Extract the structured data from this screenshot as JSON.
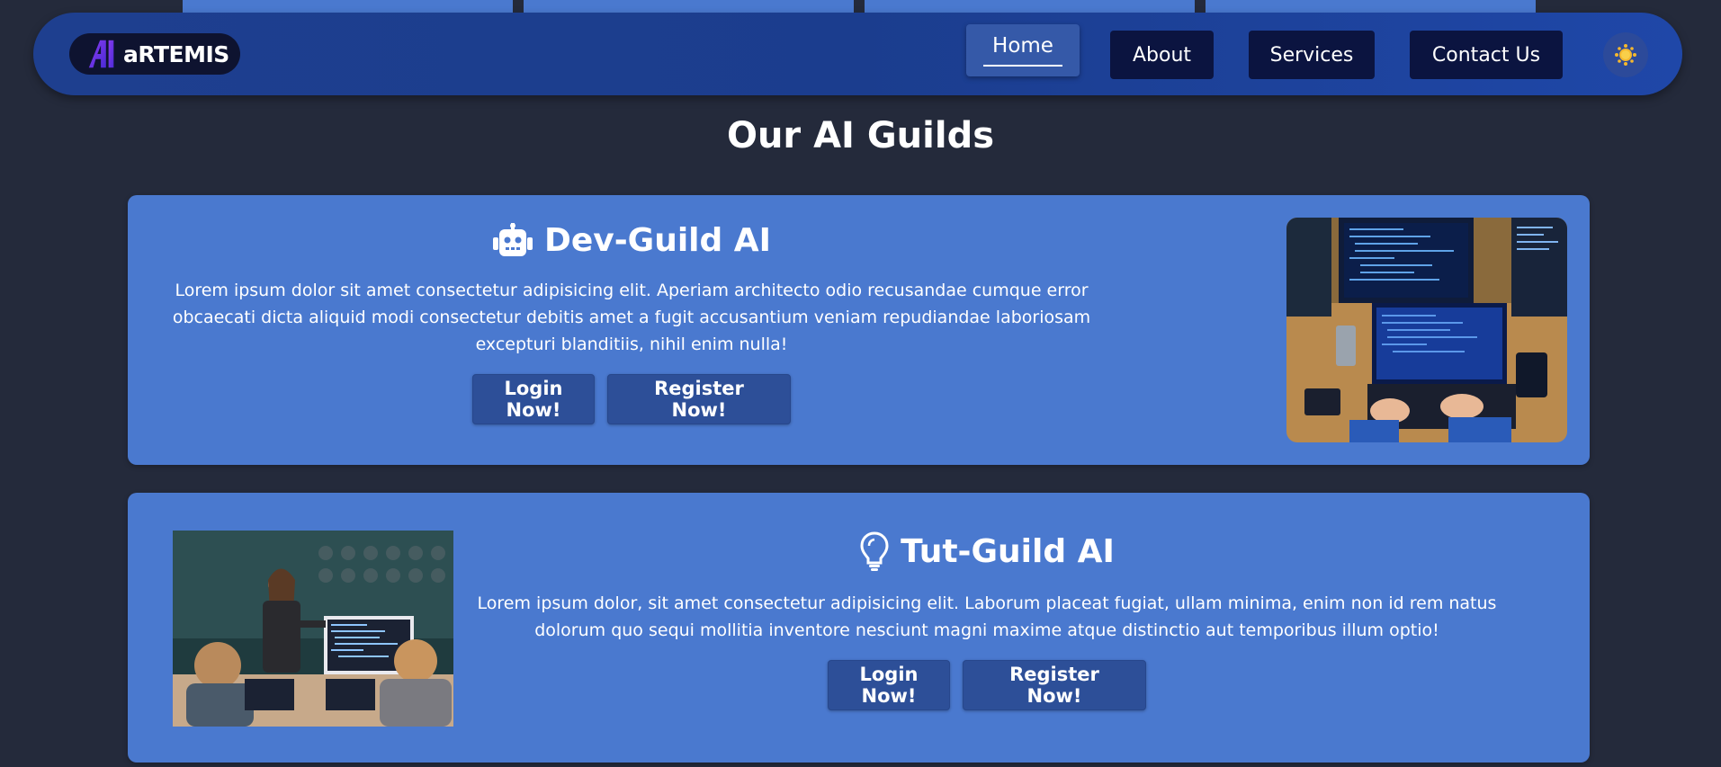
{
  "navbar": {
    "logo_text": "aRTEMIS",
    "links": [
      "Home",
      "About",
      "Services",
      "Contact Us"
    ],
    "active": "Home"
  },
  "section": {
    "title": "Our AI Guilds"
  },
  "guilds": [
    {
      "title": "Dev-Guild AI",
      "icon": "robot-icon",
      "description": "Lorem ipsum dolor sit amet consectetur adipisicing elit. Aperiam architecto odio recusandae cumque error obcaecati dicta aliquid modi consectetur debitis amet a fugit accusantium veniam repudiandae laboriosam excepturi blanditiis, nihil enim nulla!",
      "login_label": "Login Now!",
      "register_label": "Register Now!"
    },
    {
      "title": "Tut-Guild AI",
      "icon": "lightbulb-icon",
      "description": "Lorem ipsum dolor, sit amet consectetur adipisicing elit. Laborum placeat fugiat, ullam minima, enim non id rem natus dolorum quo sequi mollitia inventore nesciunt magni maxime atque distinctio aut temporibus illum optio!",
      "login_label": "Login Now!",
      "register_label": "Register Now!"
    }
  ],
  "colors": {
    "background": "#242a3b",
    "navbar": "#1e3f8f",
    "card": "#4a79cf",
    "button": "#2d4f98",
    "nav_button": "#0b1440"
  }
}
